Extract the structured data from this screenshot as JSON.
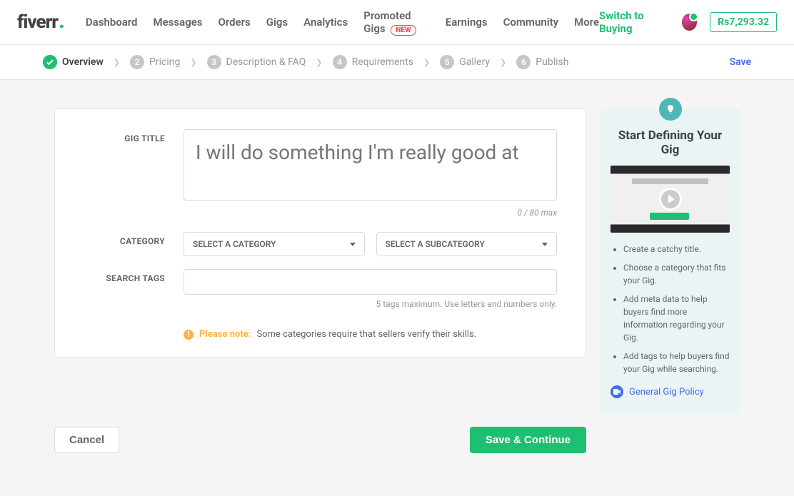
{
  "header": {
    "logo": "fiverr",
    "nav": [
      "Dashboard",
      "Messages",
      "Orders",
      "Gigs",
      "Analytics",
      "Promoted Gigs",
      "Earnings",
      "Community",
      "More"
    ],
    "promoted_badge": "NEW",
    "switch_label": "Switch to Buying",
    "balance": "Rs7,293.32"
  },
  "steps": {
    "items": [
      {
        "num": "✓",
        "label": "Overview",
        "active": true
      },
      {
        "num": "2",
        "label": "Pricing"
      },
      {
        "num": "3",
        "label": "Description & FAQ"
      },
      {
        "num": "4",
        "label": "Requirements"
      },
      {
        "num": "5",
        "label": "Gallery"
      },
      {
        "num": "6",
        "label": "Publish"
      }
    ],
    "save": "Save"
  },
  "form": {
    "gig_title_label": "GIG TITLE",
    "gig_title_placeholder": "I will do something I'm really good at",
    "char_count": "0 / 80 max",
    "category_label": "CATEGORY",
    "select_category": "SELECT A CATEGORY",
    "select_subcategory": "SELECT A SUBCATEGORY",
    "tags_label": "SEARCH TAGS",
    "tags_hint": "5 tags maximum. Use letters and numbers only.",
    "note_label": "Please note:",
    "note_text": "Some categories require that sellers verify their skills."
  },
  "aside": {
    "title": "Start Defining Your Gig",
    "tips": [
      "Create a catchy title.",
      "Choose a category that fits your Gig.",
      "Add meta data to help buyers find more information regarding your Gig.",
      "Add tags to help buyers find your Gig while searching."
    ],
    "policy": "General Gig Policy"
  },
  "actions": {
    "cancel": "Cancel",
    "save_continue": "Save & Continue"
  }
}
